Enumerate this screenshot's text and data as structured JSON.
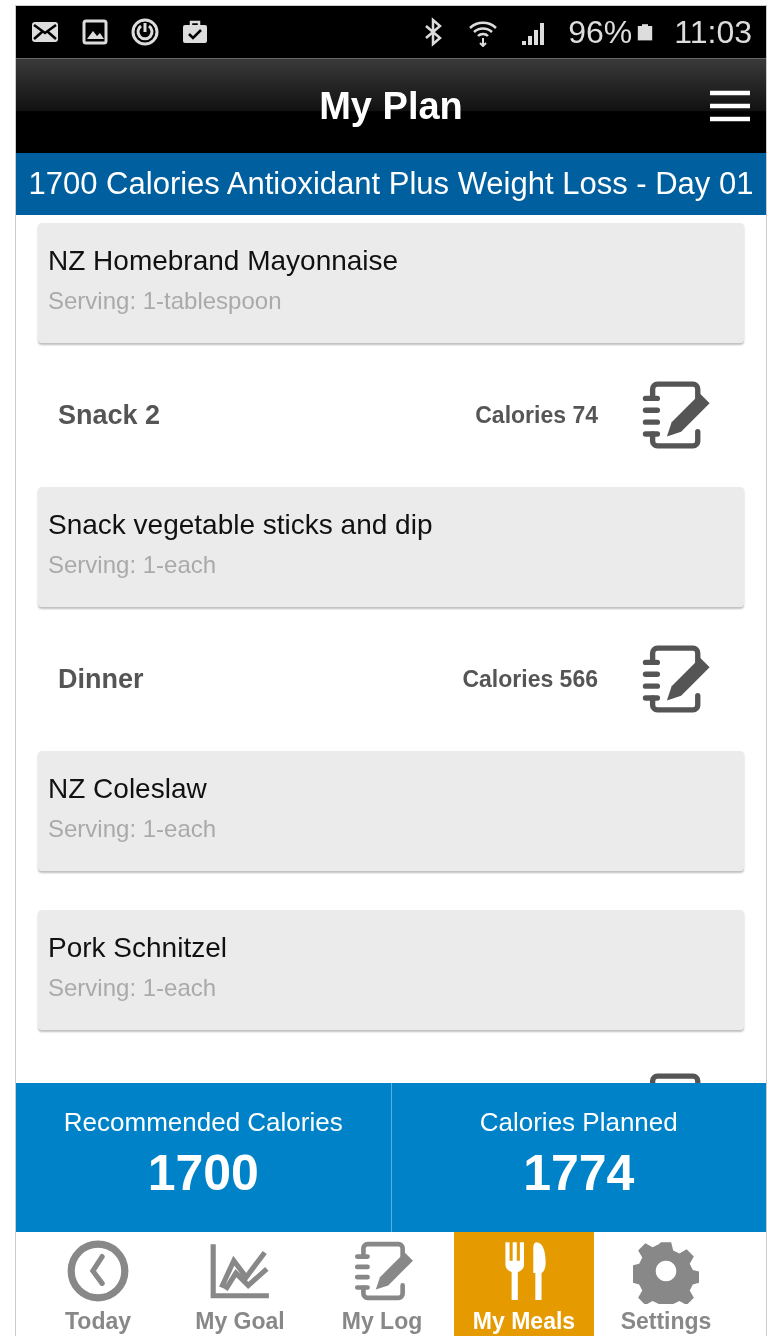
{
  "status_bar": {
    "battery": "96%",
    "time": "11:03"
  },
  "header": {
    "title": "My Plan"
  },
  "banner": "1700 Calories Antioxidant Plus Weight Loss - Day 01",
  "items": [
    {
      "kind": "food",
      "name": "NZ Homebrand Mayonnaise",
      "serving": "Serving: 1-tablespoon"
    },
    {
      "kind": "meal",
      "name": "Snack 2",
      "calories": "Calories 74"
    },
    {
      "kind": "food",
      "name": "Snack vegetable sticks and dip",
      "serving": "Serving: 1-each"
    },
    {
      "kind": "meal",
      "name": "Dinner",
      "calories": "Calories 566"
    },
    {
      "kind": "food",
      "name": "NZ Coleslaw",
      "serving": "Serving: 1-each"
    },
    {
      "kind": "food",
      "name": "Pork Schnitzel",
      "serving": "Serving: 1-each"
    }
  ],
  "summary": [
    {
      "label": "Recommended Calories",
      "value": "1700"
    },
    {
      "label": "Calories Planned",
      "value": "1774"
    }
  ],
  "tabs": [
    {
      "label": "Today",
      "kind": "clock",
      "selected": false
    },
    {
      "label": "My Goal",
      "kind": "chart",
      "selected": false
    },
    {
      "label": "My Log",
      "kind": "log",
      "selected": false
    },
    {
      "label": "My Meals",
      "kind": "meals",
      "selected": true
    },
    {
      "label": "Settings",
      "kind": "gear",
      "selected": false
    }
  ]
}
